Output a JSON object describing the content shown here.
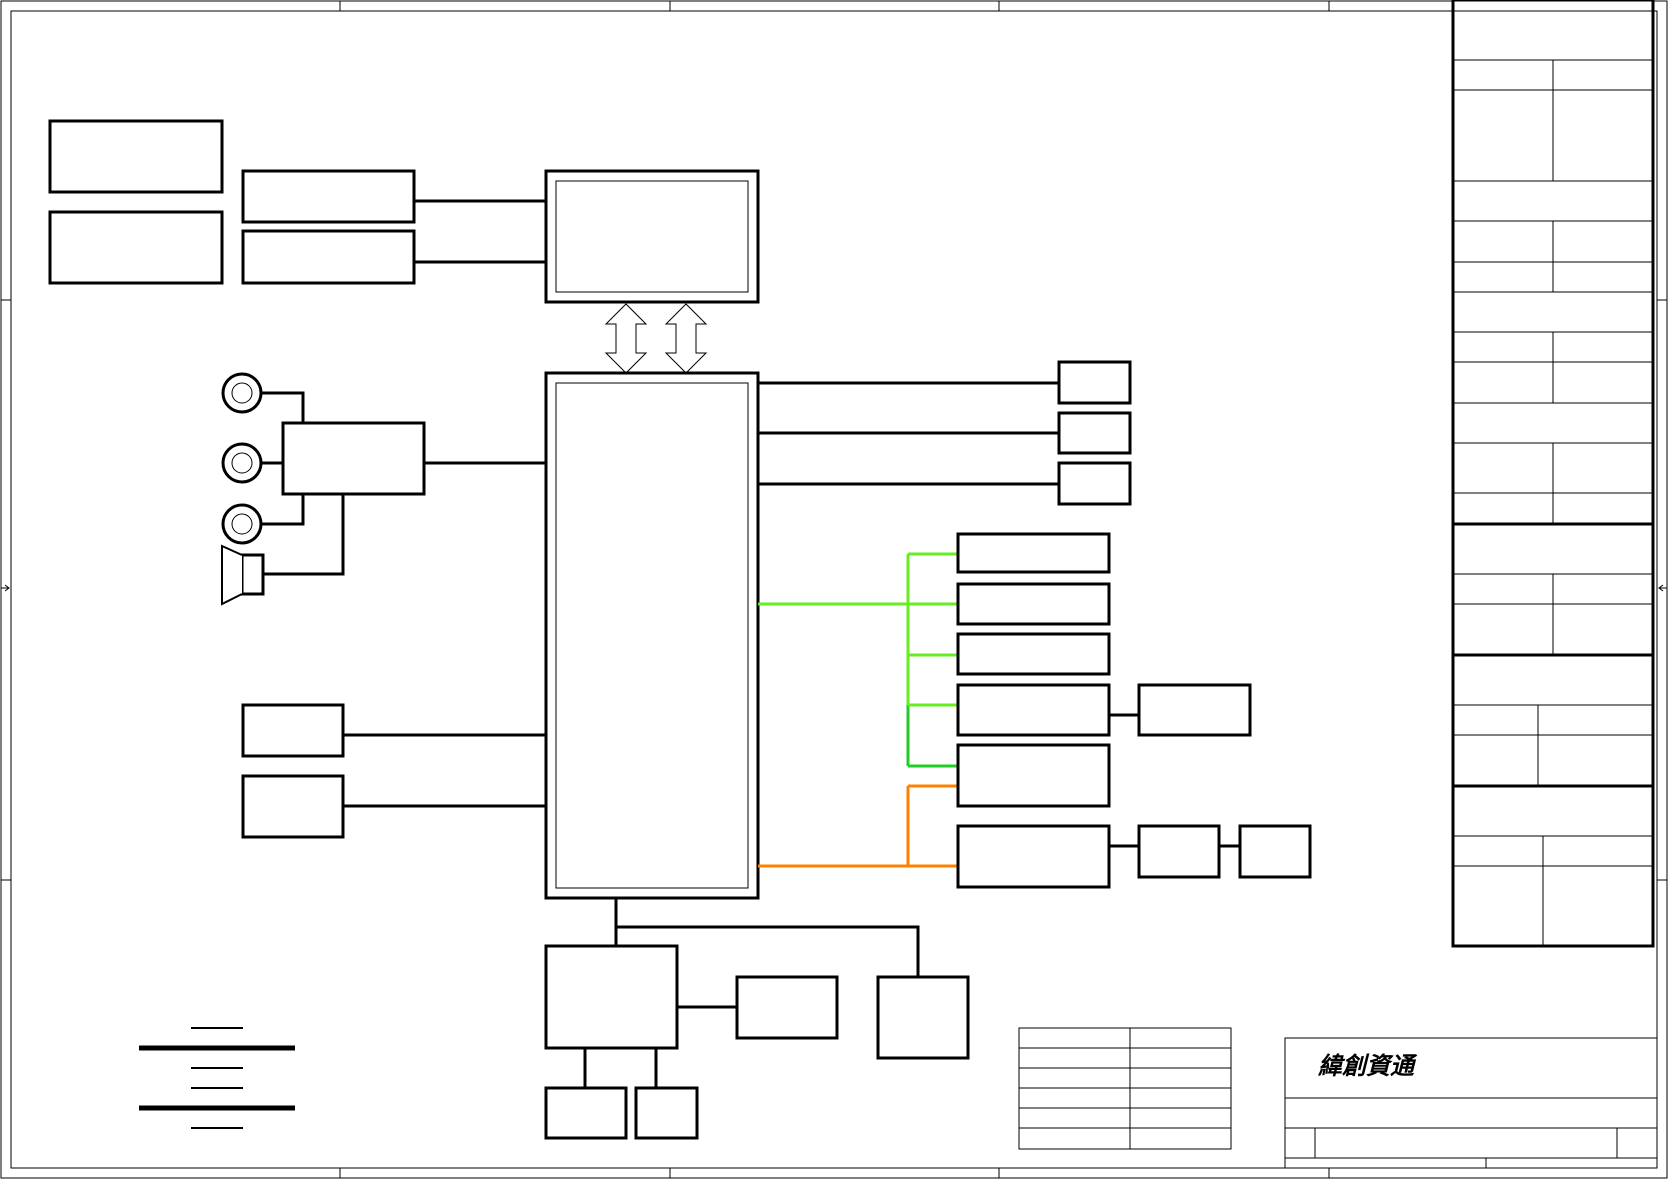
{
  "document": {
    "type": "schematic-block-diagram",
    "page_background": "#ffffff",
    "line_color": "#000000"
  },
  "title_block": {
    "company_name": "緯創資通"
  },
  "colors": {
    "green_bus": "#66ee22",
    "green_bus_dark": "#22cc22",
    "orange_bus": "#ff8000",
    "block_stroke": "#000000"
  },
  "icons": {
    "audio_jack": "audio-jack-icon",
    "speaker": "speaker-icon",
    "bidirectional_arrow": "double-arrow-icon"
  }
}
